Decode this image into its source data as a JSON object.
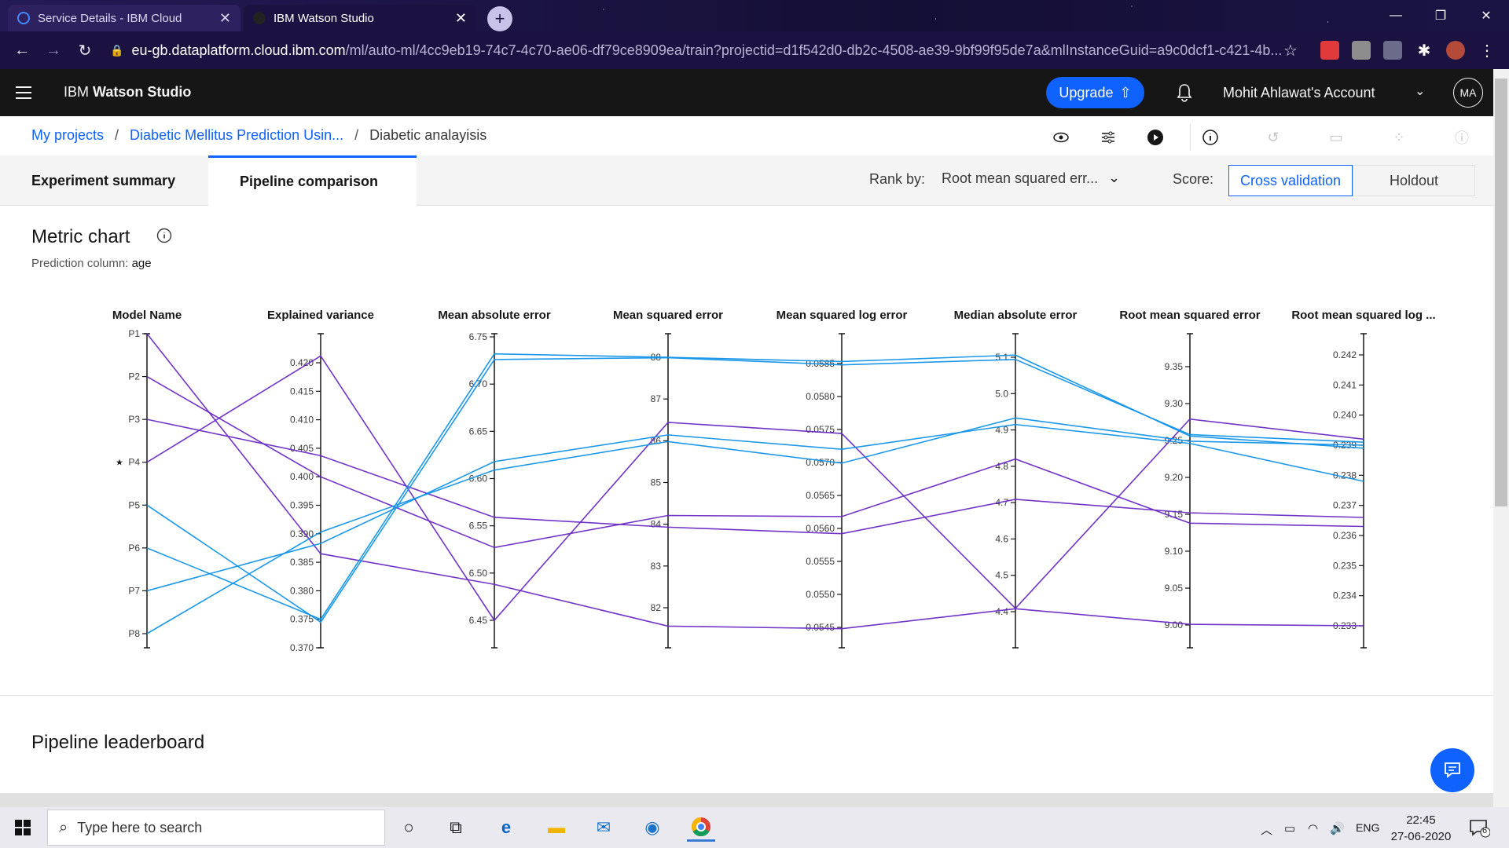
{
  "browser": {
    "tabs": [
      {
        "title": "Service Details - IBM Cloud"
      },
      {
        "title": "IBM Watson Studio"
      }
    ],
    "url_host": "eu-gb.dataplatform.cloud.ibm.com",
    "url_path": "/ml/auto-ml/4cc9eb19-74c7-4c70-ae06-df79ce8909ea/train?projectid=d1f542d0-db2c-4508-ae39-9bf99f95de7a&mlInstanceGuid=a9c0dcf1-c421-4b..."
  },
  "header": {
    "brand_prefix": "IBM ",
    "brand": "Watson Studio",
    "upgrade": "Upgrade",
    "account": "Mohit Ahlawat's Account",
    "avatar": "MA"
  },
  "breadcrumb": {
    "items": [
      "My projects",
      "Diabetic Mellitus Prediction Usin..."
    ],
    "current": "Diabetic analayisis"
  },
  "tabs": {
    "summary": "Experiment summary",
    "comparison": "Pipeline comparison"
  },
  "rank": {
    "label": "Rank by:",
    "value": "Root mean squared err..."
  },
  "score": {
    "label": "Score:",
    "options": [
      "Cross validation",
      "Holdout"
    ],
    "selected": "Cross validation"
  },
  "metric": {
    "title": "Metric chart",
    "prediction_label": "Prediction column:",
    "prediction_value": "age"
  },
  "leaderboard": {
    "title": "Pipeline leaderboard"
  },
  "taskbar": {
    "search_placeholder": "Type here to search",
    "lang": "ENG",
    "time": "22:45",
    "date": "27-06-2020",
    "notif_count": "6"
  },
  "colors": {
    "blue": "#1192e8",
    "purple": "#6929c4",
    "accent": "#0f62fe"
  },
  "chart_data": {
    "type": "parallel_coordinates",
    "axes": [
      {
        "name": "Model Name",
        "categorical": true,
        "ticks": [
          "P1",
          "P2",
          "P3",
          "P4",
          "P5",
          "P6",
          "P7",
          "P8"
        ],
        "star": "P4"
      },
      {
        "name": "Explained variance",
        "ticks": [
          "0.420",
          "0.415",
          "0.410",
          "0.405",
          "0.400",
          "0.395",
          "0.390",
          "0.385",
          "0.380",
          "0.375",
          "0.370"
        ]
      },
      {
        "name": "Mean absolute error",
        "ticks": [
          "6.75",
          "6.70",
          "6.65",
          "6.60",
          "6.55",
          "6.50",
          "6.45"
        ]
      },
      {
        "name": "Mean squared error",
        "ticks": [
          "88",
          "87",
          "86",
          "85",
          "84",
          "83",
          "82"
        ]
      },
      {
        "name": "Mean squared log error",
        "ticks": [
          "0.0585",
          "0.0580",
          "0.0575",
          "0.0570",
          "0.0565",
          "0.0560",
          "0.0555",
          "0.0550",
          "0.0545"
        ]
      },
      {
        "name": "Median absolute error",
        "ticks": [
          "5.1",
          "5.0",
          "4.9",
          "4.8",
          "4.7",
          "4.6",
          "4.5",
          "4.4"
        ]
      },
      {
        "name": "Root mean squared error",
        "ticks": [
          "9.35",
          "9.30",
          "9.25",
          "9.20",
          "9.15",
          "9.10",
          "9.05",
          "9.00"
        ]
      },
      {
        "name": "Root mean squared log ...",
        "ticks": [
          "0.242",
          "0.241",
          "0.240",
          "0.239",
          "0.238",
          "0.237",
          "0.236",
          "0.235",
          "0.234",
          "0.233"
        ]
      }
    ],
    "series": [
      {
        "pipeline": "P1",
        "color": "purple",
        "values": [
          0.3865,
          6.488,
          81.56,
          0.05448,
          4.408,
          9.001,
          0.233
        ]
      },
      {
        "pipeline": "P2",
        "color": "purple",
        "values": [
          0.4,
          6.527,
          84.21,
          0.05618,
          4.82,
          9.138,
          0.2363
        ]
      },
      {
        "pipeline": "P3",
        "color": "purple",
        "values": [
          0.4037,
          6.559,
          83.93,
          0.05592,
          4.709,
          9.152,
          0.2366
        ]
      },
      {
        "pipeline": "P4",
        "color": "purple",
        "values": [
          0.4212,
          6.45,
          86.44,
          0.05744,
          4.409,
          9.279,
          0.2392
        ]
      },
      {
        "pipeline": "P5",
        "color": "blue",
        "values": [
          0.3745,
          6.726,
          87.99,
          0.05848,
          5.094,
          9.258,
          0.2391
        ]
      },
      {
        "pipeline": "P6",
        "color": "blue",
        "values": [
          0.375,
          6.732,
          88.0,
          0.05853,
          5.106,
          9.256,
          0.2389
        ]
      },
      {
        "pipeline": "P7",
        "color": "blue",
        "values": [
          0.3883,
          6.618,
          86.14,
          0.0572,
          4.915,
          9.246,
          0.2378
        ]
      },
      {
        "pipeline": "P8",
        "color": "blue",
        "values": [
          0.3903,
          6.609,
          85.98,
          0.05699,
          4.933,
          9.249,
          0.239
        ]
      }
    ]
  }
}
